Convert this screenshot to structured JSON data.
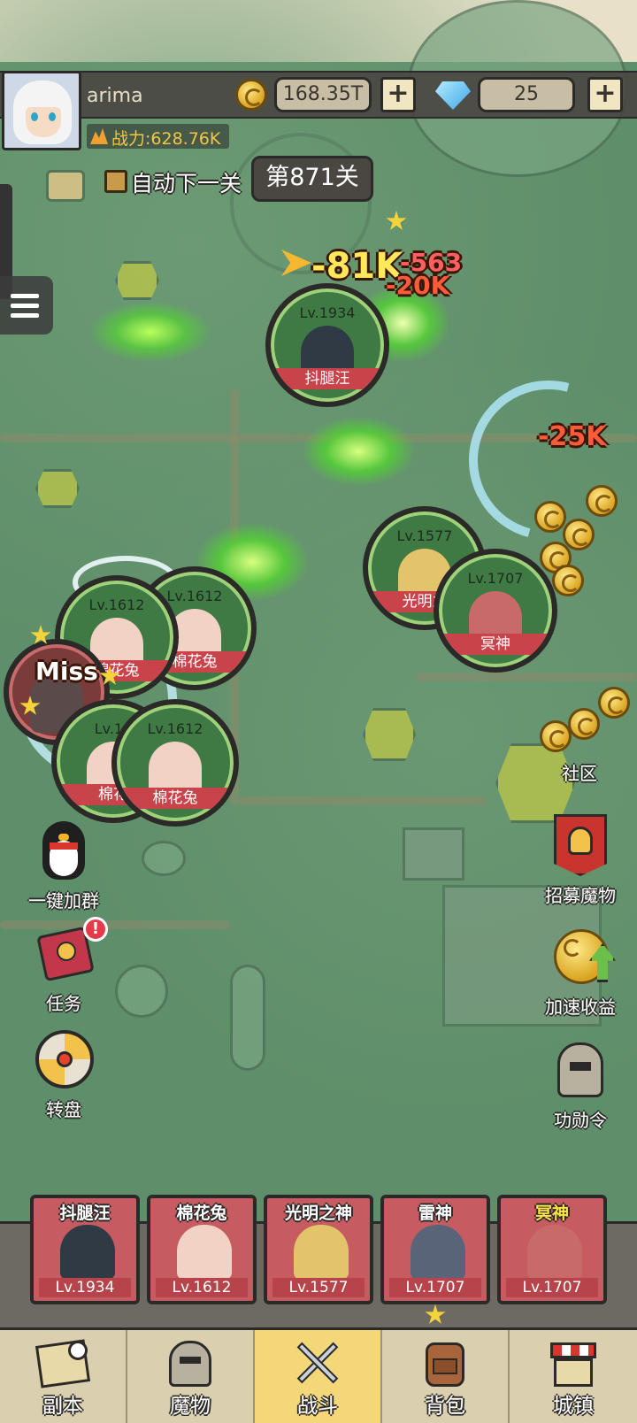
{
  "player": {
    "name": "arima",
    "power": "战力:628.76K"
  },
  "currency": {
    "gold": "168.35T",
    "diamond": "25",
    "plus": "+"
  },
  "stage": {
    "auto_next_label": "自动下一关",
    "current": "第871关"
  },
  "damage_numbers": [
    "-81K",
    "-563",
    "-20K",
    "-25K",
    "Miss"
  ],
  "monsters": [
    {
      "level": "Lv.1934",
      "name": "抖腿汪"
    },
    {
      "level": "Lv.1577",
      "name": "光明之"
    },
    {
      "level": "Lv.1707",
      "name": "冥神"
    },
    {
      "level": "Lv.1612",
      "name": "棉花兔"
    },
    {
      "level": "Lv.1612",
      "name": "棉花兔"
    },
    {
      "level": "Lv.16",
      "name": "棉花"
    },
    {
      "level": "Lv.1612",
      "name": "棉花兔"
    }
  ],
  "right_buttons": [
    {
      "label": "社区",
      "icon": "community-icon"
    },
    {
      "label": "招募魔物",
      "icon": "recruit-banner-icon"
    },
    {
      "label": "加速收益",
      "icon": "speed-income-icon"
    },
    {
      "label": "功勋令",
      "icon": "helmet-icon"
    }
  ],
  "left_buttons": [
    {
      "label": "一键加群",
      "icon": "penguin-icon"
    },
    {
      "label": "任务",
      "icon": "quest-book-icon",
      "badge": "!"
    },
    {
      "label": "转盘",
      "icon": "wheel-icon"
    }
  ],
  "team": [
    {
      "name": "抖腿汪",
      "level": "Lv.1934"
    },
    {
      "name": "棉花兔",
      "level": "Lv.1612"
    },
    {
      "name": "光明之神",
      "level": "Lv.1577"
    },
    {
      "name": "雷神",
      "level": "Lv.1707"
    },
    {
      "name": "冥神",
      "level": "Lv.1707"
    }
  ],
  "nav": [
    {
      "label": "副本",
      "icon": "map-icon"
    },
    {
      "label": "魔物",
      "icon": "monster-helmet-icon"
    },
    {
      "label": "战斗",
      "icon": "crossed-swords-icon",
      "active": true
    },
    {
      "label": "背包",
      "icon": "backpack-icon"
    },
    {
      "label": "城镇",
      "icon": "town-icon"
    }
  ],
  "colors": {
    "accent_gold": "#f4c642",
    "monster_ring": "#9fd17a",
    "name_banner": "#c8434a",
    "nav_active": "#f4d779"
  }
}
